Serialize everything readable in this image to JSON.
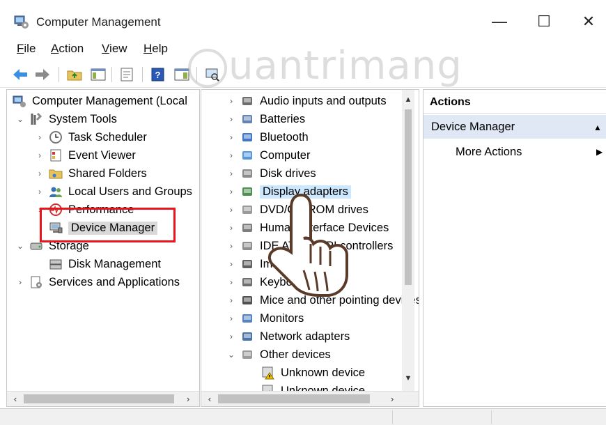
{
  "window": {
    "title": "Computer Management",
    "controls": {
      "minimize": "—",
      "maximize": "☐",
      "close": "✕"
    }
  },
  "menu": [
    {
      "accel": "F",
      "rest": "ile"
    },
    {
      "accel": "A",
      "rest": "ction"
    },
    {
      "accel": "V",
      "rest": "iew"
    },
    {
      "accel": "H",
      "rest": "elp"
    }
  ],
  "watermark": "uantrimang",
  "left_tree": {
    "root": "Computer Management (Local",
    "system_tools": "System Tools",
    "task_scheduler": "Task Scheduler",
    "event_viewer": "Event Viewer",
    "shared_folders": "Shared Folders",
    "local_users": "Local Users and Groups",
    "performance": "Performance",
    "device_manager": "Device Manager",
    "storage": "Storage",
    "disk_management": "Disk Management",
    "services": "Services and Applications"
  },
  "device_tree": {
    "items": [
      "Audio inputs and outputs",
      "Batteries",
      "Bluetooth",
      "Computer",
      "Disk drives",
      "Display adapters",
      "DVD/CD-ROM drives",
      "Human Interface Devices",
      "IDE ATA/ATAPI controllers",
      "Imaging devices",
      "Keyboards",
      "Mice and other pointing devices",
      "Monitors",
      "Network adapters",
      "Other devices"
    ],
    "children": [
      "Unknown device",
      "Unknown device"
    ]
  },
  "actions": {
    "title": "Actions",
    "section": "Device Manager",
    "more": "More Actions"
  },
  "colors": {
    "red_highlight": "#e8141b",
    "actions_section_bg": "#dfe8f4",
    "selection_bg": "#cce8ff"
  }
}
